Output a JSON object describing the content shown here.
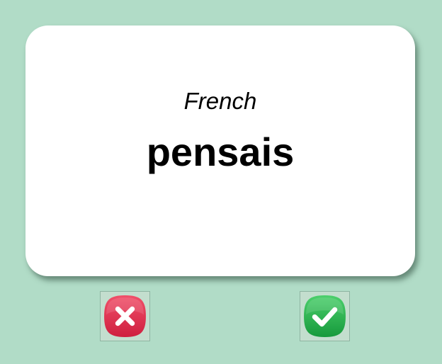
{
  "card": {
    "language": "French",
    "word": "pensais"
  },
  "actions": {
    "wrong_icon": "close-icon",
    "correct_icon": "check-icon"
  },
  "colors": {
    "background": "#b1dcc7",
    "card": "#ffffff",
    "wrong": "#e0314f",
    "correct": "#23b24a"
  }
}
